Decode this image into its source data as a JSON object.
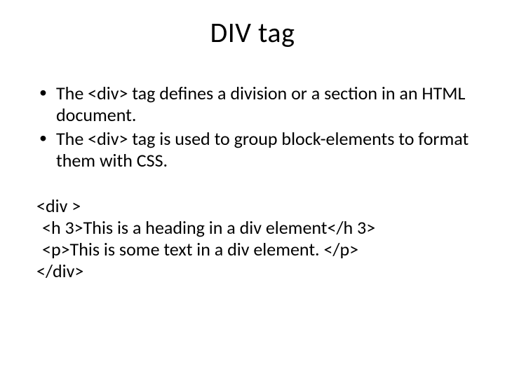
{
  "title": "DIV tag",
  "bullets": [
    "The <div> tag defines a division or a section in an HTML document.",
    "The <div> tag is used to group block-elements to format them with CSS."
  ],
  "code": {
    "line1": "<div >",
    "line2": "<h 3>This is a heading in a div element</h 3>",
    "line3": "<p>This is some text in a div element. </p>",
    "line4": "</div>"
  }
}
